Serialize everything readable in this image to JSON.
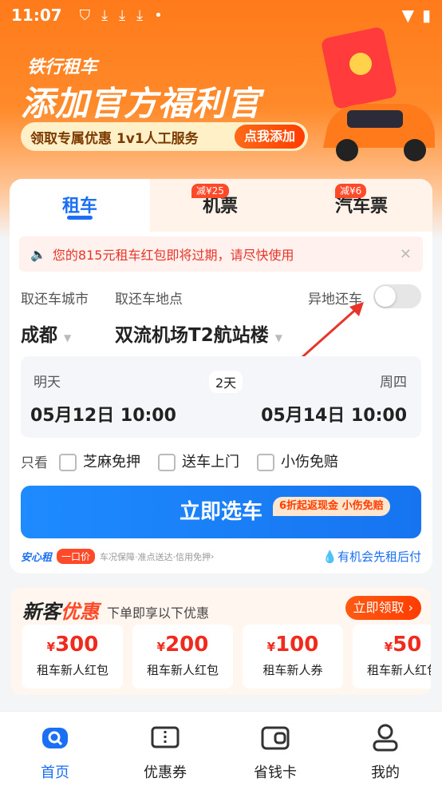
{
  "status_bar": {
    "time": "11:07"
  },
  "banner": {
    "brand": "铁行租车",
    "headline": "添加官方福利官",
    "pill_text": "领取专属优惠 1v1人工服务",
    "pill_button": "点我添加"
  },
  "tabs": [
    {
      "label": "租车"
    },
    {
      "label": "机票",
      "badge": "减¥25"
    },
    {
      "label": "汽车票",
      "badge": "减¥6"
    }
  ],
  "notice": {
    "text": "您的815元租车红包即将过期，请尽快使用"
  },
  "form": {
    "city_label": "取还车城市",
    "location_label": "取还车地点",
    "return_label": "异地还车",
    "city": "成都",
    "location": "双流机场T2航站楼"
  },
  "dates": {
    "pickup_day": "明天",
    "pickup_date": "05月12日 10:00",
    "duration": "2天",
    "return_day": "周四",
    "return_date": "05月14日 10:00"
  },
  "filters": {
    "label": "只看",
    "options": [
      "芝麻免押",
      "送车上门",
      "小伤免赔"
    ]
  },
  "select_button": {
    "label": "立即选车",
    "promo": "6折起返现金 小伤免赔"
  },
  "footer_row": {
    "brand": "安心租",
    "tag": "一口价",
    "desc": "车况保障·准点送达·信用免押",
    "right": "有机会先租后付"
  },
  "new_customer": {
    "title_a": "新客",
    "title_b": "优惠",
    "subtitle": "下单即享以下优惠",
    "claim_button": "立即领取",
    "coupons": [
      {
        "amount": "300",
        "currency": "¥",
        "name": "租车新人红包"
      },
      {
        "amount": "200",
        "currency": "¥",
        "name": "租车新人红包"
      },
      {
        "amount": "100",
        "currency": "¥",
        "name": "租车新人券"
      },
      {
        "amount": "50",
        "currency": "¥",
        "name": "租车新人红包"
      }
    ]
  },
  "nav": [
    {
      "label": "首页",
      "icon": "car-search-icon",
      "color": "#1a6ff5"
    },
    {
      "label": "优惠券",
      "icon": "ticket-icon"
    },
    {
      "label": "省钱卡",
      "icon": "wallet-icon"
    },
    {
      "label": "我的",
      "icon": "user-icon"
    }
  ],
  "colors": {
    "accent": "#1a6ff5",
    "banner": "#ff7a1a",
    "warning": "#e8352a"
  }
}
